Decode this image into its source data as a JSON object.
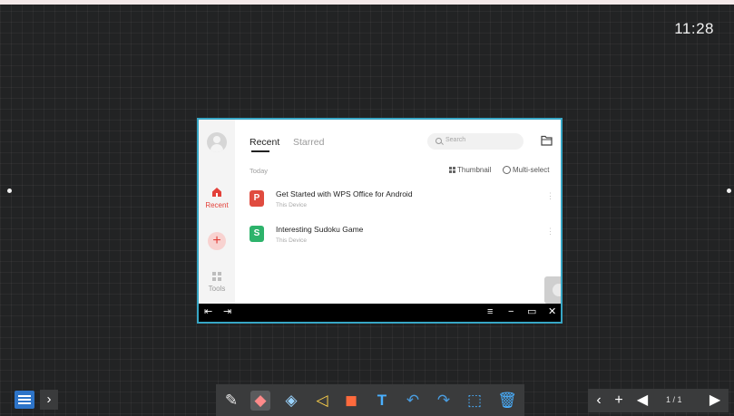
{
  "clock": "11:28",
  "app": {
    "sidebar": {
      "items": [
        {
          "label": "Recent",
          "icon": "home-icon",
          "active": true
        },
        {
          "label": "Tools",
          "icon": "grid-icon",
          "active": false
        }
      ],
      "accent_color": "#e3413a"
    },
    "tabs": [
      {
        "label": "Recent",
        "active": true
      },
      {
        "label": "Starred",
        "active": false
      }
    ],
    "search": {
      "placeholder": "Search"
    },
    "section_label": "Today",
    "view_options": {
      "thumbnail": "Thumbnail",
      "multi_select": "Multi-select"
    },
    "files": [
      {
        "name": "Get Started with WPS Office for Android",
        "location": "This Device",
        "icon": "presentation-file-icon",
        "glyph": "P",
        "color": "#e04b3f"
      },
      {
        "name": "Interesting Sudoku Game",
        "location": "This Device",
        "icon": "spreadsheet-file-icon",
        "glyph": "S",
        "color": "#2db36b"
      }
    ],
    "border_color": "#37a6c5"
  },
  "window_bar": {
    "icons": [
      "collapse-left-icon",
      "expand-right-icon",
      "menu-icon",
      "minimize-icon",
      "fullscreen-icon",
      "close-icon"
    ]
  },
  "toolbar": {
    "tools": [
      "pen-icon",
      "eraser-icon",
      "clear-eraser-icon",
      "select-shape-icon",
      "color-shapes-icon",
      "text-icon",
      "undo-icon",
      "redo-icon",
      "selection-cursor-icon",
      "delete-icon"
    ],
    "active_tool": "eraser-icon"
  },
  "page_nav": {
    "indicator": "1 / 1"
  }
}
